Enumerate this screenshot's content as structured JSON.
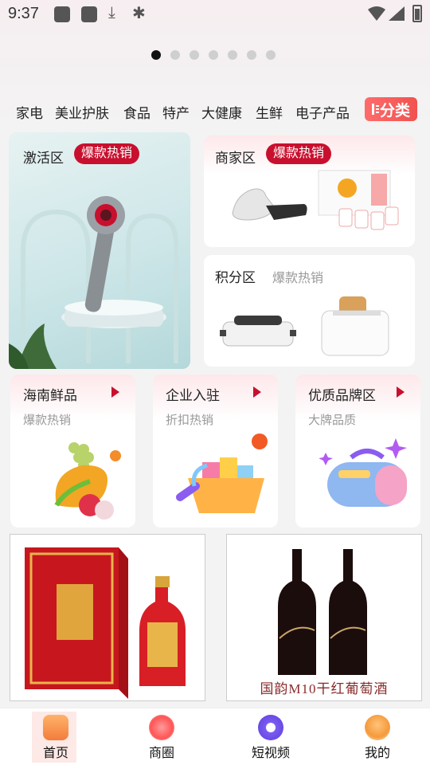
{
  "status_bar": {
    "time": "9:37"
  },
  "banner": {
    "dot_count": 7,
    "active_index": 0
  },
  "categories": [
    "家电",
    "美业护肤",
    "食品",
    "特产",
    "大健康",
    "生鲜",
    "电子产品"
  ],
  "category_button": {
    "label": "分类"
  },
  "zones": {
    "activation": {
      "title": "激活区",
      "badge": "爆款热销"
    },
    "merchant": {
      "title": "商家区",
      "badge": "爆款热销"
    },
    "points": {
      "title": "积分区",
      "subtitle": "爆款热销"
    }
  },
  "mini_cards": [
    {
      "title": "海南鲜品",
      "subtitle": "爆款热销"
    },
    {
      "title": "企业入驻",
      "subtitle": "折扣热销"
    },
    {
      "title": "优质品牌区",
      "subtitle": "大牌品质"
    }
  ],
  "products": {
    "wine": {
      "caption": "国韵M10干红葡萄酒"
    }
  },
  "bottom_nav": [
    {
      "label": "首页",
      "active": true
    },
    {
      "label": "商圈"
    },
    {
      "label": "短视频"
    },
    {
      "label": "我的"
    }
  ],
  "colors": {
    "accent_red": "#c8102e",
    "category_button": "#f0524f"
  }
}
